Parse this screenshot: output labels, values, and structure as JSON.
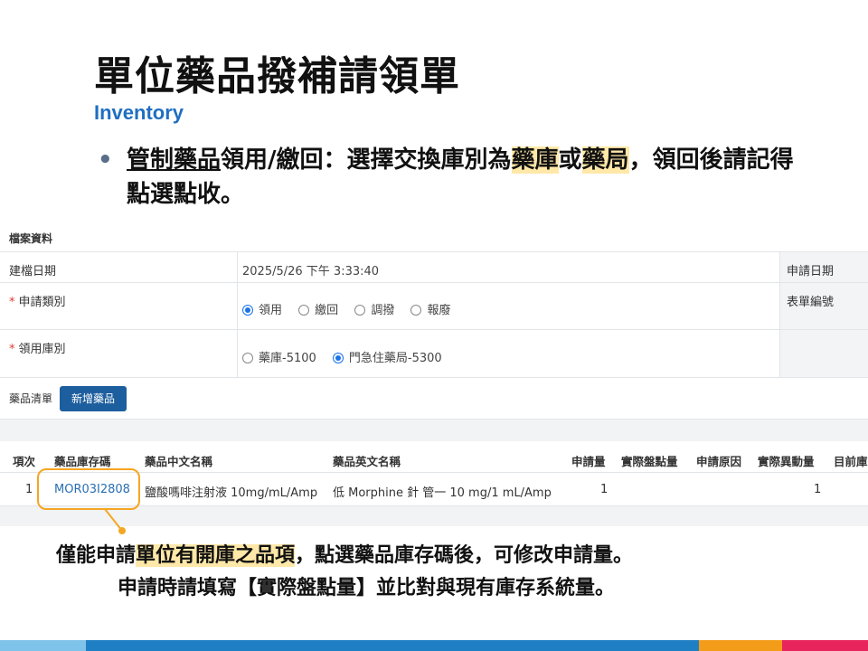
{
  "slide": {
    "title": "單位藥品撥補請領單",
    "subtitle": "Inventory",
    "bullet": {
      "dot": "•",
      "part1": "管制藥品",
      "part2": "領用/繳回：選擇交換庫別為",
      "part3": "藥庫",
      "part4": "或",
      "part5": "藥局",
      "part6": "，領回後請記得點選點收。"
    },
    "note": {
      "line1_a": "僅能申請",
      "line1_b": "單位有開庫之品項",
      "line1_c": "，點選藥品庫存碼後，可修改申請量。",
      "line2": "申請時請填寫【實際盤點量】並比對與現有庫存系統量。"
    }
  },
  "form": {
    "section_title": "檔案資料",
    "created_label": "建檔日期",
    "created_value": "2025/5/26 下午 3:33:40",
    "apply_date_label": "申請日期",
    "apply_type_label": "申請類別",
    "apply_type_options": [
      "領用",
      "繳回",
      "調撥",
      "報廢"
    ],
    "form_no_label": "表單編號",
    "warehouse_label": "領用庫別",
    "warehouse_options": [
      "藥庫-5100",
      "門急住藥局-5300"
    ],
    "required_mark": "*"
  },
  "drug_list": {
    "label": "藥品清單",
    "add_button": "新增藥品",
    "columns": [
      "項次",
      "藥品庫存碼",
      "藥品中文名稱",
      "藥品英文名稱",
      "申請量",
      "實際盤點量",
      "申請原因",
      "實際異動量",
      "目前庫"
    ],
    "rows": [
      {
        "index": "1",
        "code": "MOR03I2808",
        "name_zh": "鹽酸嗎啡注射液 10mg/mL/Amp",
        "name_en": "低 Morphine 針 管一 10 mg/1 mL/Amp",
        "qty": "1",
        "actual_change": "1"
      }
    ]
  },
  "colors": {
    "title_accent": "#1f6fc0",
    "highlight": "#ffe8a8",
    "callout": "#f5a623",
    "button": "#1d5e9e",
    "bar_light": "#7ec3ea",
    "bar_blue": "#1f7fc4",
    "bar_orange": "#f39c1a",
    "bar_red": "#e8245c"
  }
}
